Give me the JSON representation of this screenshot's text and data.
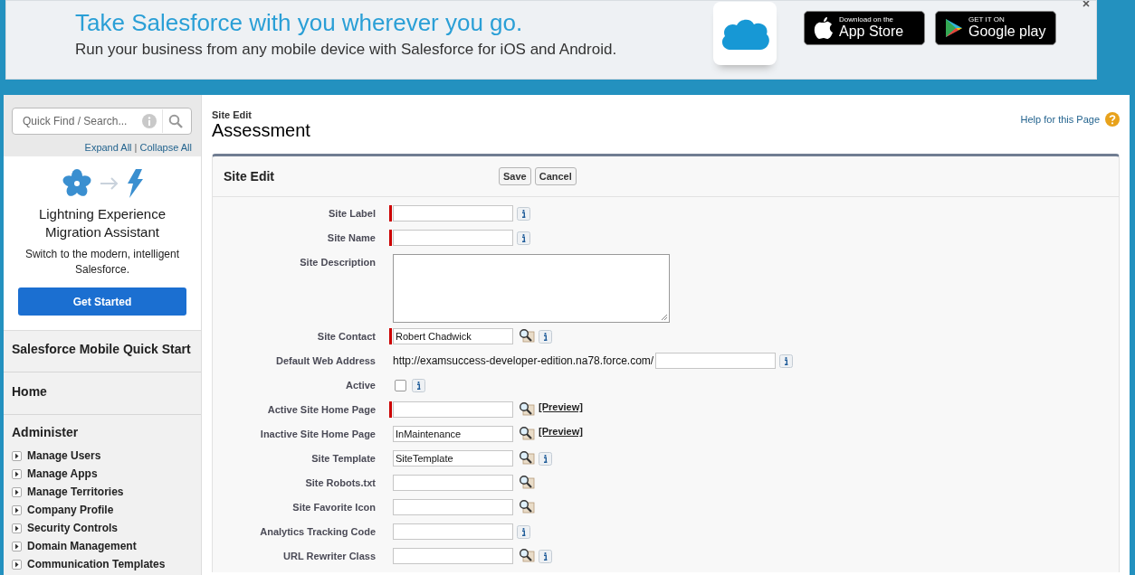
{
  "banner": {
    "headline": "Take Salesforce with you wherever you go.",
    "subline": "Run your business from any mobile device with Salesforce for iOS and Android.",
    "stores": [
      {
        "kind": "apple",
        "small": "Download on the",
        "big": "App Store"
      },
      {
        "kind": "google",
        "small": "GET IT ON",
        "big": "Google play"
      }
    ]
  },
  "sidebar": {
    "search": {
      "placeholder": "Quick Find / Search..."
    },
    "expand_all": "Expand All",
    "separator": "|",
    "collapse_all": "Collapse All",
    "promo": {
      "title": "Lightning Experience Migration Assistant",
      "text": "Switch to the modern, intelligent Salesforce.",
      "button": "Get Started"
    },
    "sections": [
      {
        "label": "Salesforce Mobile Quick Start"
      },
      {
        "label": "Home"
      }
    ],
    "group": {
      "label": "Administer",
      "items": [
        {
          "label": "Manage Users",
          "expanded": false
        },
        {
          "label": "Manage Apps",
          "expanded": false
        },
        {
          "label": "Manage Territories",
          "expanded": false
        },
        {
          "label": "Company Profile",
          "expanded": false
        },
        {
          "label": "Security Controls",
          "expanded": false
        },
        {
          "label": "Domain Management",
          "expanded": false
        },
        {
          "label": "Communication Templates",
          "expanded": false
        }
      ]
    }
  },
  "page": {
    "breadcrumb": "Site Edit",
    "title": "Assessment",
    "help": "Help for this Page"
  },
  "form": {
    "title": "Site Edit",
    "buttons": [
      "Save",
      "Cancel"
    ],
    "fields": [
      {
        "label": "Site Label",
        "kind": "text",
        "required": true,
        "info": true
      },
      {
        "label": "Site Name",
        "kind": "text",
        "required": true,
        "info": true
      },
      {
        "label": "Site Description",
        "kind": "textarea"
      },
      {
        "label": "Site Contact",
        "kind": "text",
        "value": "Robert Chadwick",
        "required": true,
        "lookup": true,
        "info": true
      },
      {
        "label": "Default Web Address",
        "kind": "url",
        "prefix": "http://examsuccess-developer-edition.na78.force.com/",
        "info": true
      },
      {
        "label": "Active",
        "kind": "checkbox",
        "checked": false,
        "info": true
      },
      {
        "label": "Active Site Home Page",
        "kind": "text",
        "required": true,
        "lookup": true,
        "link": "[Preview]"
      },
      {
        "label": "Inactive Site Home Page",
        "kind": "text",
        "value": "InMaintenance",
        "lookup": true,
        "link": "[Preview]"
      },
      {
        "label": "Site Template",
        "kind": "text",
        "value": "SiteTemplate",
        "lookup": true,
        "info": true
      },
      {
        "label": "Site Robots.txt",
        "kind": "text",
        "lookup": true
      },
      {
        "label": "Site Favorite Icon",
        "kind": "text",
        "lookup": true
      },
      {
        "label": "Analytics Tracking Code",
        "kind": "text",
        "info": true
      },
      {
        "label": "URL Rewriter Class",
        "kind": "text",
        "lookup": true,
        "info": true
      }
    ]
  }
}
